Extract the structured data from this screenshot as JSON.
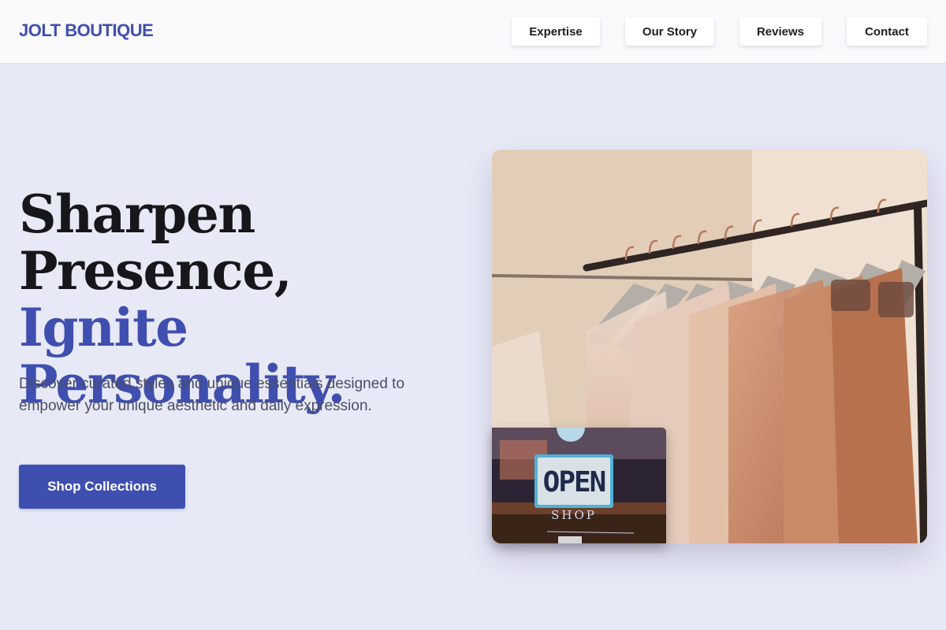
{
  "header": {
    "brand": "JOLT BOUTIQUE",
    "nav": [
      "Expertise",
      "Our Story",
      "Reviews",
      "Contact"
    ]
  },
  "hero": {
    "headline_line1": "Sharpen",
    "headline_line2_dark": "Presence, ",
    "headline_line2_accent": "Ignite",
    "headline_line3_accent": "Personality.",
    "subtext": "Discover curated styles and unique essentials designed to empower your unique aesthetic and daily expression.",
    "cta_label": "Shop Collections"
  },
  "images": {
    "main": "clothing-rack-photo",
    "inset": "open-sign-photo",
    "inset_sign_text": "OPEN",
    "inset_shop_text": "SHOP"
  },
  "colors": {
    "accent": "#3f4fb0",
    "background": "#e8e9f6",
    "header_bg": "#fafafd",
    "text_dark": "#17171b",
    "text_muted": "#4c4f63"
  }
}
